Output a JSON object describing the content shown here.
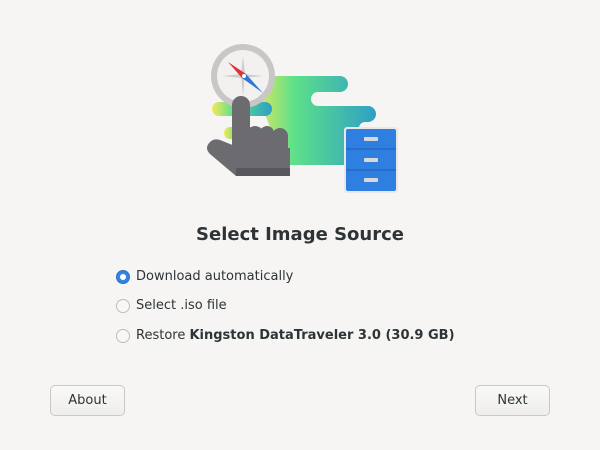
{
  "title": "Select Image Source",
  "options": [
    {
      "label": "Download automatically",
      "selected": true
    },
    {
      "label": "Select .iso file",
      "selected": false
    },
    {
      "label_prefix": "Restore",
      "label_bold": "Kingston DataTraveler 3.0 (30.9 GB)",
      "selected": false
    }
  ],
  "buttons": {
    "about": "About",
    "next": "Next"
  },
  "colors": {
    "accent": "#3584e4",
    "background": "#f6f5f4"
  }
}
